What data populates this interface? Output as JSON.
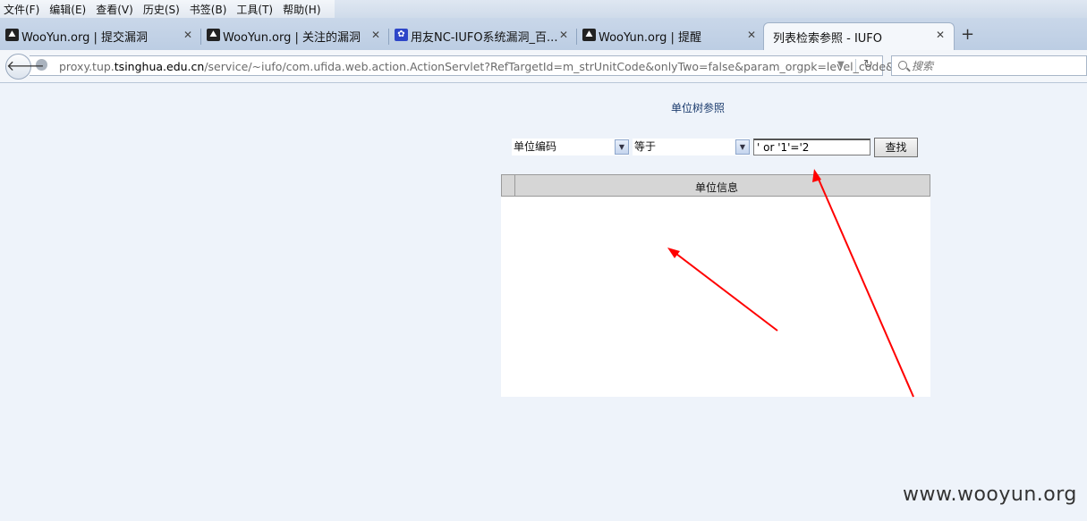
{
  "menu": [
    "文件(F)",
    "编辑(E)",
    "查看(V)",
    "历史(S)",
    "书签(B)",
    "工具(T)",
    "帮助(H)"
  ],
  "tabs": [
    {
      "label": "WooYun.org | 提交漏洞",
      "close": "✕",
      "icon": "wooyun-icon"
    },
    {
      "label": "WooYun.org | 关注的漏洞",
      "close": "✕",
      "icon": "wooyun-icon"
    },
    {
      "label": "用友NC-IUFO系统漏洞_百...",
      "close": "✕",
      "icon": "baidu-paw-icon"
    },
    {
      "label": "WooYun.org | 提醒",
      "close": "✕",
      "icon": "wooyun-icon"
    },
    {
      "label": "列表检索参照 - IUFO",
      "close": "✕",
      "active": true
    }
  ],
  "new_tab_symbol": "+",
  "url": {
    "prefix": "proxy.tup.",
    "host": "tsinghua.edu.cn",
    "path": "/service/~iufo/com.ufida.web.action.ActionServlet?RefTargetId=m_strUnitCode&onlyTwo=false&param_orgpk=level_code&"
  },
  "search_placeholder": "搜索",
  "page": {
    "title": "单位树参照",
    "field_select": "单位编码",
    "operator_select": "等于",
    "query_value": "' or '1'='2",
    "find_button": "查找",
    "grid_header": "单位信息"
  },
  "annotation_color": "#ff0000",
  "watermark": "www.wooyun.org"
}
